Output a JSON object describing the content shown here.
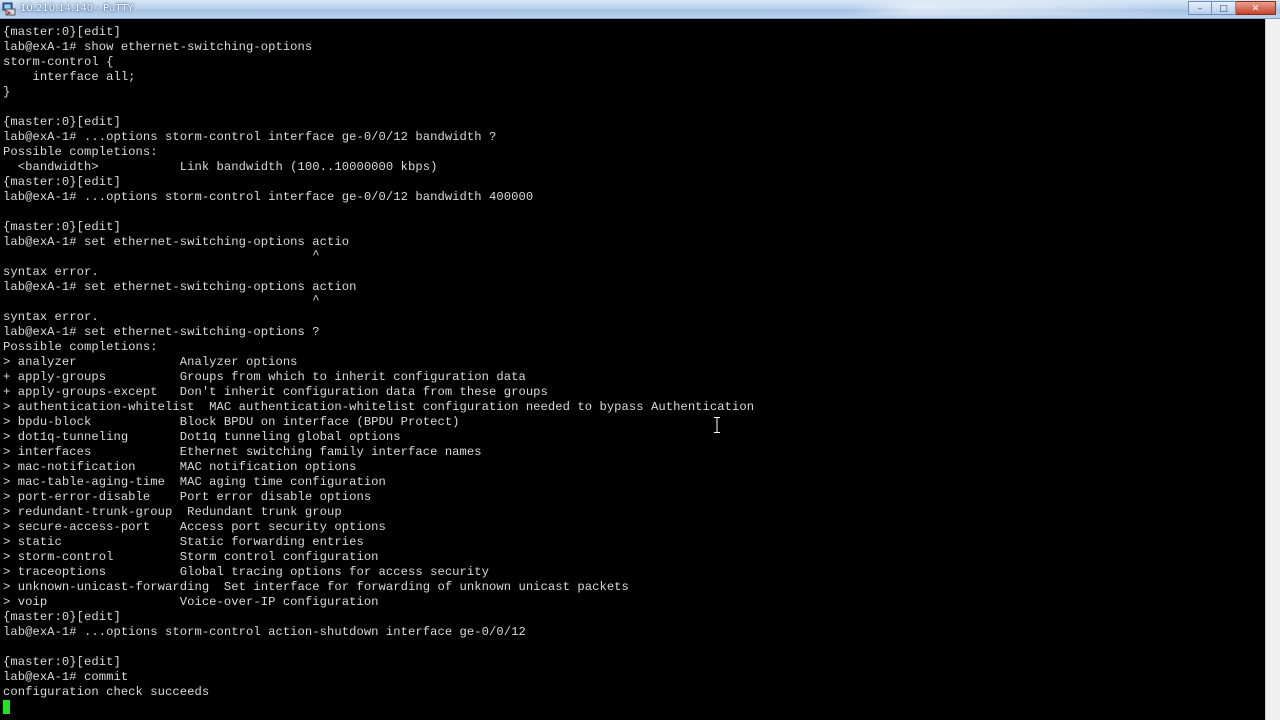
{
  "window": {
    "title": "10.210.14.140 - PuTTY",
    "buttons": {
      "minimize": "–",
      "maximize": "□",
      "close": "✕"
    }
  },
  "terminal": {
    "lines": [
      "{master:0}[edit]",
      "lab@exA-1# show ethernet-switching-options",
      "storm-control {",
      "    interface all;",
      "}",
      "",
      "{master:0}[edit]",
      "lab@exA-1# ...options storm-control interface ge-0/0/12 bandwidth ?",
      "Possible completions:",
      "  <bandwidth>           Link bandwidth (100..10000000 kbps)",
      "{master:0}[edit]",
      "lab@exA-1# ...options storm-control interface ge-0/0/12 bandwidth 400000",
      "",
      "{master:0}[edit]",
      "lab@exA-1# set ethernet-switching-options actio",
      "                                          ^",
      "syntax error.",
      "lab@exA-1# set ethernet-switching-options action",
      "                                          ^",
      "syntax error.",
      "lab@exA-1# set ethernet-switching-options ?",
      "Possible completions:",
      "> analyzer              Analyzer options",
      "+ apply-groups          Groups from which to inherit configuration data",
      "+ apply-groups-except   Don't inherit configuration data from these groups",
      "> authentication-whitelist  MAC authentication-whitelist configuration needed to bypass Authentication",
      "> bpdu-block            Block BPDU on interface (BPDU Protect)",
      "> dot1q-tunneling       Dot1q tunneling global options",
      "> interfaces            Ethernet switching family interface names",
      "> mac-notification      MAC notification options",
      "> mac-table-aging-time  MAC aging time configuration",
      "> port-error-disable    Port error disable options",
      "> redundant-trunk-group  Redundant trunk group",
      "> secure-access-port    Access port security options",
      "> static                Static forwarding entries",
      "> storm-control         Storm control configuration",
      "> traceoptions          Global tracing options for access security",
      "> unknown-unicast-forwarding  Set interface for forwarding of unknown unicast packets",
      "> voip                  Voice-over-IP configuration",
      "{master:0}[edit]",
      "lab@exA-1# ...options storm-control action-shutdown interface ge-0/0/12",
      "",
      "{master:0}[edit]",
      "lab@exA-1# commit",
      "configuration check succeeds"
    ]
  },
  "colors": {
    "background": "#000000",
    "text": "#d9d9d9",
    "cursor": "#22e022"
  }
}
